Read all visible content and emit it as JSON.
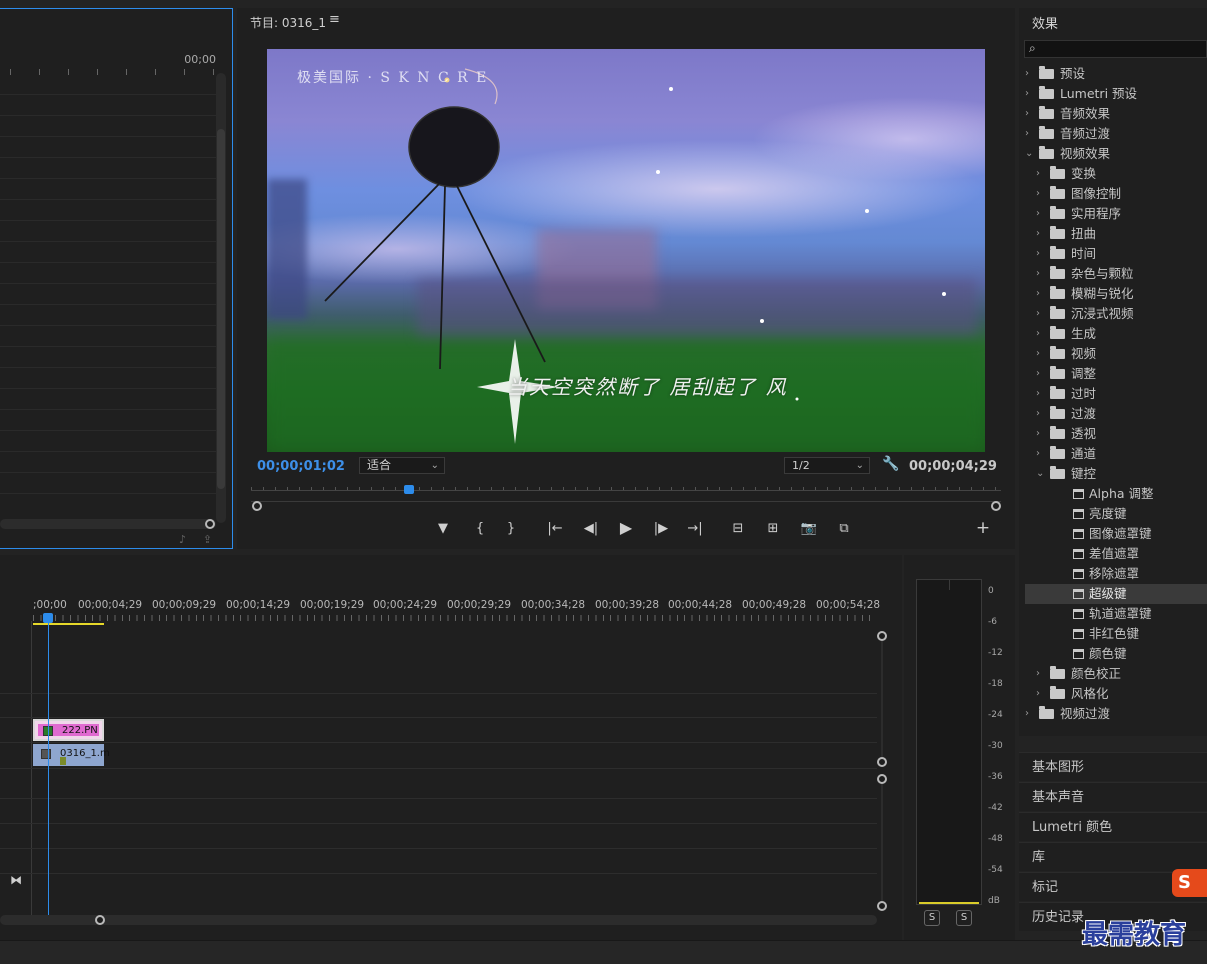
{
  "source_monitor": {
    "timecode": "00;00"
  },
  "program_monitor": {
    "title": "节目: 0316_1",
    "menu_glyph": "≡",
    "watermark": "极美国际 · S K N C R E",
    "subtitle": "当天空突然断了 居刮起了 风",
    "current_time": "00;00;01;02",
    "fit": "适合",
    "resolution": "1/2",
    "duration": "00;00;04;29",
    "playhead_fraction": 0.21,
    "controls": {
      "marker": "▼",
      "mark_in": "{",
      "mark_out": "}",
      "go_in": "|←",
      "step_back": "◀|",
      "play": "▶",
      "step_fwd": "|▶",
      "go_out": "→|",
      "lift": "⊟",
      "extract": "⊞",
      "export_frame": "📷",
      "compare": "⧉",
      "add": "+"
    }
  },
  "effects_panel": {
    "title": "效果",
    "search_placeholder": "",
    "items": [
      {
        "label": "预设",
        "level": 0,
        "kind": "folder-star",
        "arrow": "›"
      },
      {
        "label": "Lumetri 预设",
        "level": 0,
        "kind": "folder-star",
        "arrow": "›"
      },
      {
        "label": "音频效果",
        "level": 0,
        "kind": "folder",
        "arrow": "›"
      },
      {
        "label": "音频过渡",
        "level": 0,
        "kind": "folder",
        "arrow": "›"
      },
      {
        "label": "视频效果",
        "level": 0,
        "kind": "folder",
        "arrow": "⌄"
      },
      {
        "label": "变换",
        "level": 1,
        "kind": "folder",
        "arrow": "›"
      },
      {
        "label": "图像控制",
        "level": 1,
        "kind": "folder",
        "arrow": "›"
      },
      {
        "label": "实用程序",
        "level": 1,
        "kind": "folder",
        "arrow": "›"
      },
      {
        "label": "扭曲",
        "level": 1,
        "kind": "folder",
        "arrow": "›"
      },
      {
        "label": "时间",
        "level": 1,
        "kind": "folder",
        "arrow": "›"
      },
      {
        "label": "杂色与颗粒",
        "level": 1,
        "kind": "folder",
        "arrow": "›"
      },
      {
        "label": "模糊与锐化",
        "level": 1,
        "kind": "folder",
        "arrow": "›"
      },
      {
        "label": "沉浸式视频",
        "level": 1,
        "kind": "folder",
        "arrow": "›"
      },
      {
        "label": "生成",
        "level": 1,
        "kind": "folder",
        "arrow": "›"
      },
      {
        "label": "视频",
        "level": 1,
        "kind": "folder",
        "arrow": "›"
      },
      {
        "label": "调整",
        "level": 1,
        "kind": "folder",
        "arrow": "›"
      },
      {
        "label": "过时",
        "level": 1,
        "kind": "folder",
        "arrow": "›"
      },
      {
        "label": "过渡",
        "level": 1,
        "kind": "folder",
        "arrow": "›"
      },
      {
        "label": "透视",
        "level": 1,
        "kind": "folder",
        "arrow": "›"
      },
      {
        "label": "通道",
        "level": 1,
        "kind": "folder",
        "arrow": "›"
      },
      {
        "label": "键控",
        "level": 1,
        "kind": "folder",
        "arrow": "⌄"
      },
      {
        "label": "Alpha 调整",
        "level": 2,
        "kind": "effect",
        "arrow": ""
      },
      {
        "label": "亮度键",
        "level": 2,
        "kind": "effect",
        "arrow": ""
      },
      {
        "label": "图像遮罩键",
        "level": 2,
        "kind": "effect",
        "arrow": ""
      },
      {
        "label": "差值遮罩",
        "level": 2,
        "kind": "effect",
        "arrow": ""
      },
      {
        "label": "移除遮罩",
        "level": 2,
        "kind": "effect",
        "arrow": ""
      },
      {
        "label": "超级键",
        "level": 2,
        "kind": "effect",
        "arrow": "",
        "selected": true
      },
      {
        "label": "轨道遮罩键",
        "level": 2,
        "kind": "effect",
        "arrow": ""
      },
      {
        "label": "非红色键",
        "level": 2,
        "kind": "effect",
        "arrow": ""
      },
      {
        "label": "颜色键",
        "level": 2,
        "kind": "effect",
        "arrow": ""
      },
      {
        "label": "颜色校正",
        "level": 1,
        "kind": "folder",
        "arrow": "›"
      },
      {
        "label": "风格化",
        "level": 1,
        "kind": "folder",
        "arrow": "›"
      },
      {
        "label": "视频过渡",
        "level": 0,
        "kind": "folder",
        "arrow": "›"
      }
    ]
  },
  "side_panels": [
    "基本图形",
    "基本声音",
    "Lumetri 颜色",
    "库",
    "标记",
    "历史记录"
  ],
  "timeline": {
    "ruler_labels": [
      ";00;00",
      "00;00;04;29",
      "00;00;09;29",
      "00;00;14;29",
      "00;00;19;29",
      "00;00;24;29",
      "00;00;29;29",
      "00;00;34;28",
      "00;00;39;28",
      "00;00;44;28",
      "00;00;49;28",
      "00;00;54;28"
    ],
    "clips": {
      "v2": {
        "name": "222.PN",
        "fx": "fx"
      },
      "v1": {
        "name": "0316_1.m",
        "fx": "fx"
      }
    },
    "bowtie_glyph": "⧓"
  },
  "audio_meter": {
    "scale": [
      "0",
      "-6",
      "-12",
      "-18",
      "-24",
      "-30",
      "-36",
      "-42",
      "-48",
      "-54",
      "dB"
    ],
    "solo_labels": [
      "S",
      "S"
    ]
  },
  "overlay": {
    "watermark": "最需教育",
    "logo": "S"
  },
  "colors": {
    "accent": "#2d8ceb",
    "inout_bar": "#e6d82a",
    "clip_v2": "#e06ad0",
    "clip_v1": "#8ea6cf",
    "watermark": "#2a3f9c"
  }
}
